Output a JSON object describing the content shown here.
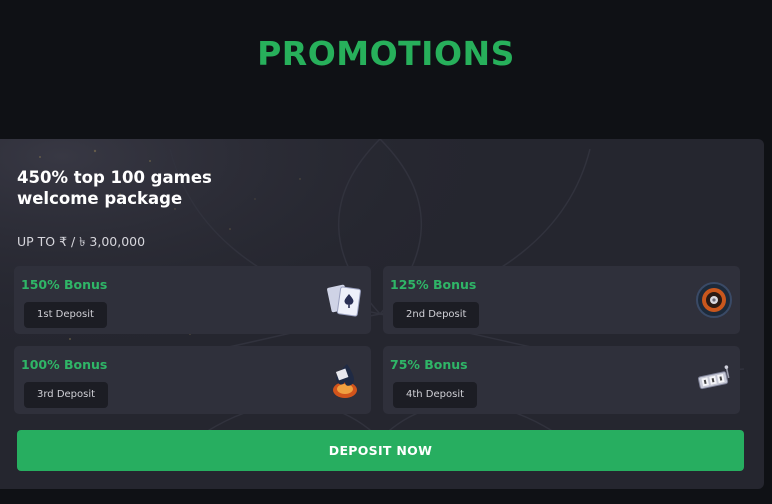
{
  "page": {
    "title": "PROMOTIONS"
  },
  "promo": {
    "headline": "450% top 100 games welcome package",
    "subline": "UP TO ₹ / ৳ 3,00,000",
    "tiles": [
      {
        "bonus": "150% Bonus",
        "deposit": "1st Deposit",
        "icon": "playing-cards-icon"
      },
      {
        "bonus": "125% Bonus",
        "deposit": "2nd Deposit",
        "icon": "roulette-wheel-icon"
      },
      {
        "bonus": "100% Bonus",
        "deposit": "3rd Deposit",
        "icon": "spade-flame-icon"
      },
      {
        "bonus": "75% Bonus",
        "deposit": "4th Deposit",
        "icon": "slot-machine-icon"
      }
    ],
    "button_label": "DEPOSIT NOW"
  },
  "colors": {
    "background": "#0f1115",
    "card": "#25262f",
    "tile": "#2f303b",
    "accent_green": "#27ae60"
  }
}
